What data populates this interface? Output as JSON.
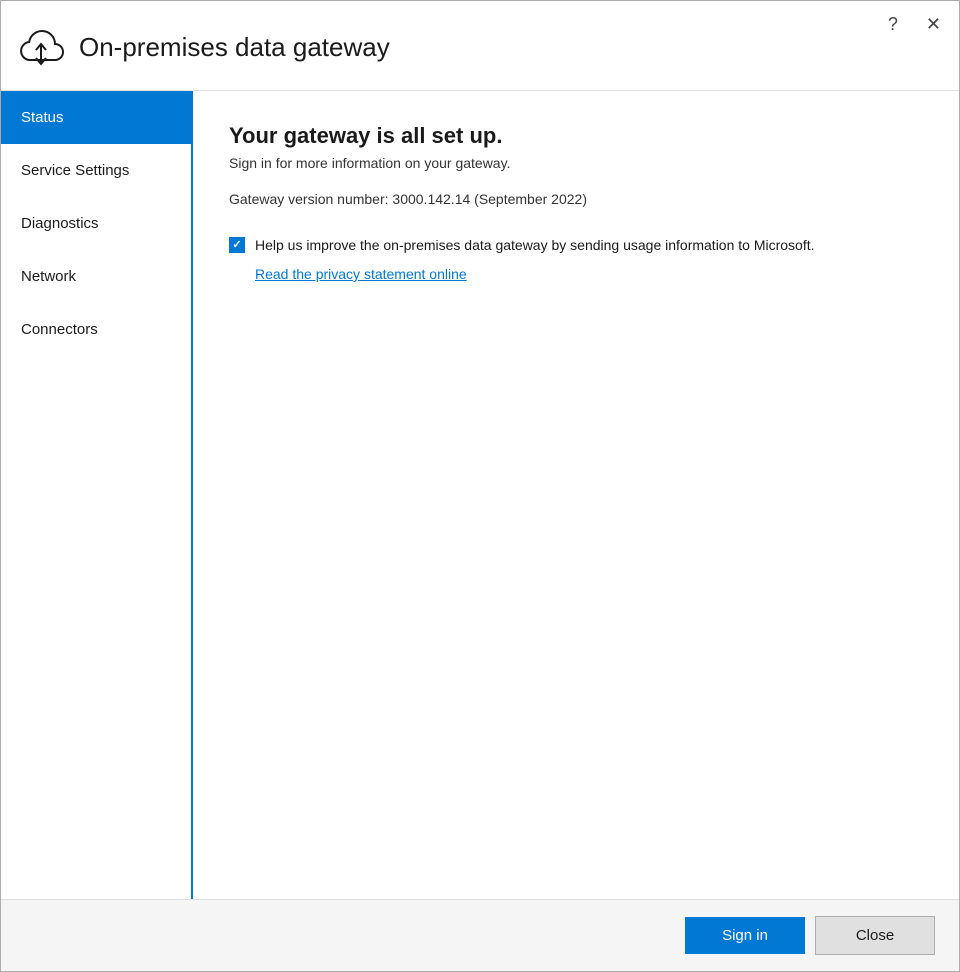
{
  "window": {
    "title": "On-premises data gateway"
  },
  "titlebar": {
    "help_label": "?",
    "close_label": "✕"
  },
  "sidebar": {
    "items": [
      {
        "id": "status",
        "label": "Status",
        "active": true
      },
      {
        "id": "service-settings",
        "label": "Service Settings",
        "active": false
      },
      {
        "id": "diagnostics",
        "label": "Diagnostics",
        "active": false
      },
      {
        "id": "network",
        "label": "Network",
        "active": false
      },
      {
        "id": "connectors",
        "label": "Connectors",
        "active": false
      }
    ]
  },
  "main": {
    "heading": "Your gateway is all set up.",
    "subtext": "Sign in for more information on your gateway.",
    "version": "Gateway version number: 3000.142.14 (September 2022)",
    "checkbox_label": "Help us improve the on-premises data gateway by sending usage information to Microsoft.",
    "privacy_link": "Read the privacy statement online"
  },
  "footer": {
    "signin_label": "Sign in",
    "close_label": "Close"
  },
  "colors": {
    "accent": "#0078d4",
    "active_bg": "#0078d4",
    "active_text": "#ffffff"
  }
}
